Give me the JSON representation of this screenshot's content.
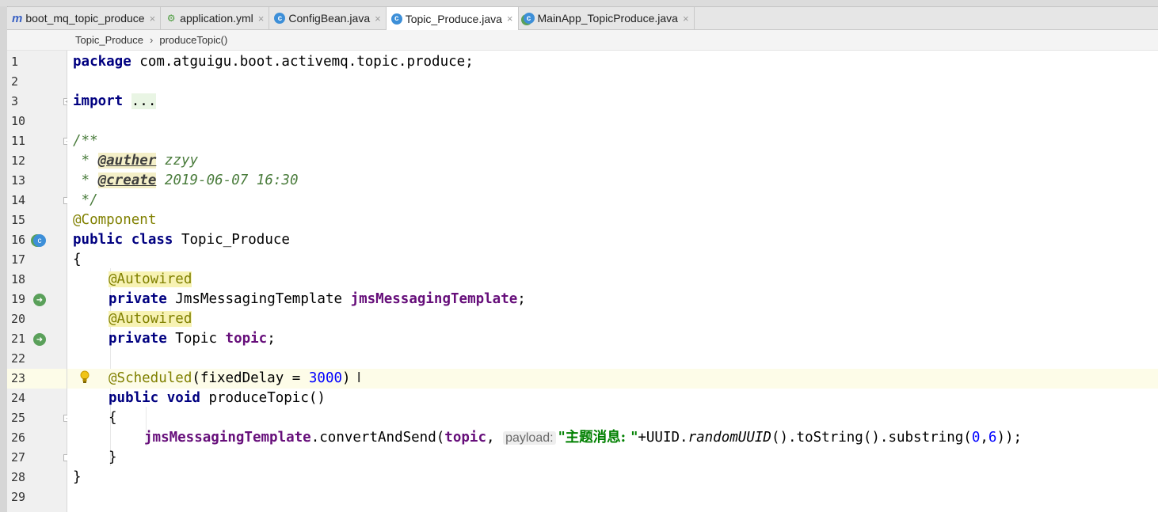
{
  "tabs": [
    {
      "label": "boot_mq_topic_produce",
      "icon": "maven-module-icon",
      "glyph": "m",
      "active": false
    },
    {
      "label": "application.yml",
      "icon": "yaml-file-icon",
      "glyph": "⚙",
      "active": false
    },
    {
      "label": "ConfigBean.java",
      "icon": "java-class-icon",
      "glyph": "c",
      "active": false
    },
    {
      "label": "Topic_Produce.java",
      "icon": "java-class-icon",
      "glyph": "c",
      "active": true
    },
    {
      "label": "MainApp_TopicProduce.java",
      "icon": "spring-boot-class-icon",
      "glyph": "c",
      "active": false
    }
  ],
  "tab_close_glyph": "×",
  "breadcrumb": {
    "class_name": "Topic_Produce",
    "separator": "›",
    "method_name": "produceTopic()"
  },
  "line_numbers": [
    "1",
    "2",
    "3",
    "10",
    "11",
    "12",
    "13",
    "14",
    "15",
    "16",
    "17",
    "18",
    "19",
    "20",
    "21",
    "22",
    "23",
    "24",
    "25",
    "26",
    "27",
    "28",
    "29"
  ],
  "code": {
    "l1_kw": "package",
    "l1_rest": " com.atguigu.boot.activemq.topic.produce;",
    "l3_kw": "import",
    "l3_fold": "...",
    "l11": "/**",
    "l12_star": " * ",
    "l12_tag": "@auther",
    "l12_val": " zzyy",
    "l13_star": " * ",
    "l13_tag": "@create",
    "l13_val": " 2019-06-07 16:30",
    "l14": " */",
    "l15": "@Component",
    "l16_kw": "public class",
    "l16_rest": " Topic_Produce",
    "l17": "{",
    "l18": "@Autowired",
    "l19_kw": "private",
    "l19_type": " JmsMessagingTemplate ",
    "l19_field": "jmsMessagingTemplate",
    "l19_end": ";",
    "l20": "@Autowired",
    "l21_kw": "private",
    "l21_type": " Topic ",
    "l21_field": "topic",
    "l21_end": ";",
    "l23_ann": "@Scheduled",
    "l23_open": "(fixedDelay = ",
    "l23_num": "3000",
    "l23_close": ")",
    "l23_cursor": "I",
    "l24_kw": "public void",
    "l24_rest": " produceTopic()",
    "l25": "{",
    "l26_field": "jmsMessagingTemplate",
    "l26_call": ".convertAndSend(",
    "l26_arg": "topic",
    "l26_comma": ", ",
    "l26_hint": "payload:",
    "l26_str": "\"主题消息: \"",
    "l26_plus": "+UUID.",
    "l26_static": "randomUUID",
    "l26_tail1": "().toString().substring(",
    "l26_n0": "0",
    "l26_commaB": ",",
    "l26_n6": "6",
    "l26_tail2": "));",
    "l27": "}",
    "l28": "}"
  },
  "colors": {
    "keyword": "#000080",
    "annotation": "#808000",
    "field": "#660e7a",
    "string": "#008000",
    "number": "#0000ff",
    "current_line": "#fdfce8"
  }
}
